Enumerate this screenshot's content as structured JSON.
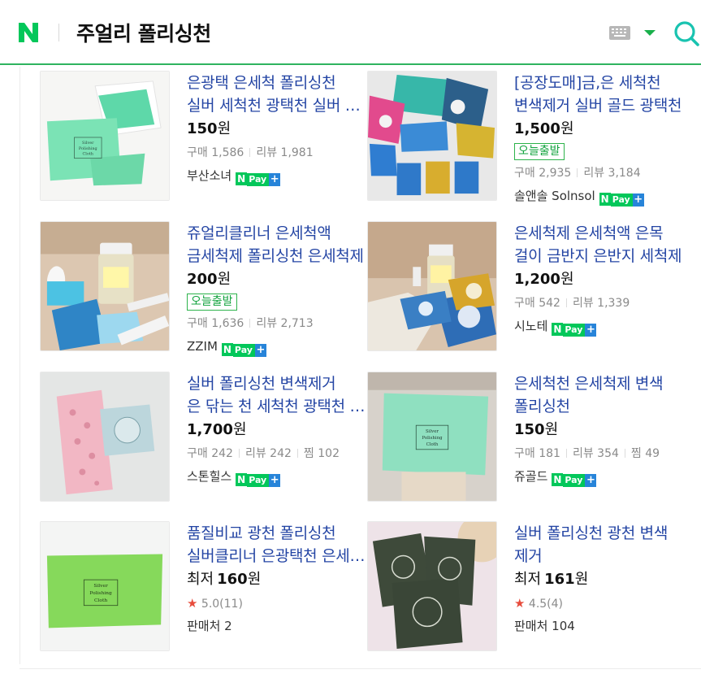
{
  "header": {
    "logo_letter": "N",
    "query": "주얼리 폴리싱천",
    "brand_color": "#03c75a"
  },
  "items": [
    {
      "title_line1": "은광택 은세척 폴리싱천",
      "title_line2": "실버 세척천 광택천 실버 폴리싱천",
      "price": "150",
      "won": "원",
      "buy_label": "구매",
      "buy": "1,586",
      "review_label": "리뷰",
      "review": "1,981",
      "seller": "부산소녀",
      "npay": true
    },
    {
      "title_line1": "[공장도매]금,은 세척천",
      "title_line2": "변색제거 실버 골드 광택천",
      "price": "1,500",
      "won": "원",
      "badge": "오늘출발",
      "buy_label": "구매",
      "buy": "2,935",
      "review_label": "리뷰",
      "review": "3,184",
      "seller": "솔앤솔 Solnsol",
      "npay": true
    },
    {
      "title_line1": "쥬얼리클리너 은세척액",
      "title_line2": "금세척제 폴리싱천 은세척제",
      "price": "200",
      "won": "원",
      "badge": "오늘출발",
      "buy_label": "구매",
      "buy": "1,636",
      "review_label": "리뷰",
      "review": "2,713",
      "seller": "ZZIM",
      "npay": true
    },
    {
      "title_line1": "은세척제 은세척액 은목",
      "title_line2": "걸이 금반지 은반지 세척제",
      "price": "1,200",
      "won": "원",
      "buy_label": "구매",
      "buy": "542",
      "review_label": "리뷰",
      "review": "1,339",
      "seller": "시노테",
      "npay": true
    },
    {
      "title_line1": "실버 폴리싱천 변색제거",
      "title_line2": "은 닦는 천 세척천 광택천 폴리싱",
      "price": "1,700",
      "won": "원",
      "buy_label": "구매",
      "buy": "242",
      "review_label": "리뷰",
      "review": "242",
      "zzim_label": "찜",
      "zzim": "102",
      "seller": "스톤힐스",
      "npay": true
    },
    {
      "title_line1": "은세척천 은세척제 변색",
      "title_line2": "폴리싱천",
      "price": "150",
      "won": "원",
      "buy_label": "구매",
      "buy": "181",
      "review_label": "리뷰",
      "review": "354",
      "zzim_label": "찜",
      "zzim": "49",
      "seller": "쥬골드",
      "npay": true
    },
    {
      "title_line1": "품질비교 광천 폴리싱천",
      "title_line2": "실버클리너 은광택천 은세척천",
      "price_prefix": "최저",
      "price": "160",
      "won": "원",
      "rating": "5.0(11)",
      "seller": "판매처 2"
    },
    {
      "title_line1": "실버 폴리싱천 광천 변색",
      "title_line2": "제거",
      "price_prefix": "최저",
      "price": "161",
      "won": "원",
      "rating": "4.5(4)",
      "seller": "판매처 104"
    }
  ],
  "npay_label": {
    "n": "N",
    "pay": "Pay",
    "plus": "+"
  },
  "cloth_text": [
    "Silver",
    "Polishing",
    "Cloth"
  ]
}
